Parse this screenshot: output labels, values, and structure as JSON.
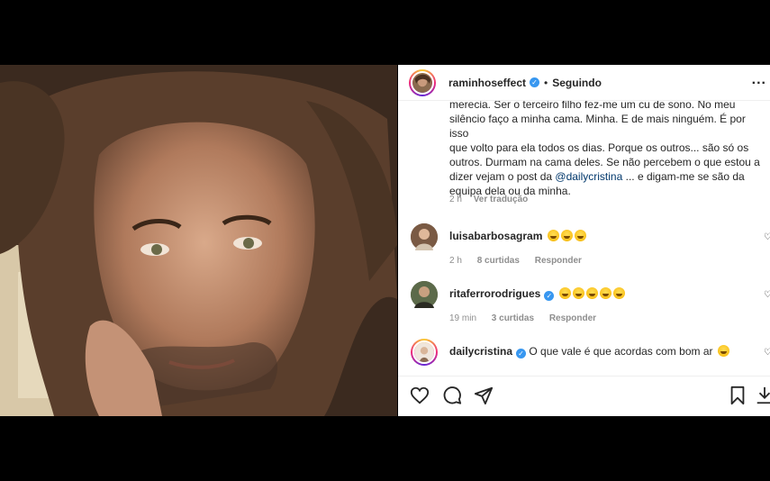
{
  "post": {
    "author": "raminhoseffect",
    "follow_status": "Seguindo",
    "separator": "•",
    "more": "...",
    "caption_lines": [
      "merecia. Ser o terceiro filho fez-me um cu de sono. No meu",
      "silêncio faço a minha cama. Minha. E de mais ninguém. É por isso",
      "que volto para ela todos os dias. Porque os outros... são só os",
      "outros. Durmam na cama deles. Se não percebem o que estou a",
      "dizer vejam o post da"
    ],
    "caption_mention": "@dailycristina",
    "caption_after_mention": " ... e digam-me se são da",
    "caption_last_line": "equipa dela ou da minha.",
    "time": "2 h",
    "translate": "Ver tradução"
  },
  "comments": [
    {
      "user": "luisabarbosagram",
      "verified": false,
      "text": "",
      "emojis": 3,
      "time": "2 h",
      "likes": "8 curtidas",
      "reply": "Responder",
      "avatar_color": "#8b6a50"
    },
    {
      "user": "ritaferrorodrigues",
      "verified": true,
      "text": "",
      "emojis": 5,
      "time": "19 min",
      "likes": "3 curtidas",
      "reply": "Responder",
      "avatar_color": "#6a6a50"
    },
    {
      "user": "dailycristina",
      "verified": true,
      "text": "O que vale é que acordas com bom ar",
      "emojis": 1,
      "time": "",
      "likes": "",
      "reply": "",
      "avatar_color": "#c9a890"
    }
  ],
  "colors": {
    "verified": "#3897f0",
    "mention": "#00376b",
    "muted": "#8e8e8e"
  },
  "icons": [
    "heart-icon",
    "comment-icon",
    "share-icon",
    "bookmark-icon",
    "download-icon"
  ]
}
